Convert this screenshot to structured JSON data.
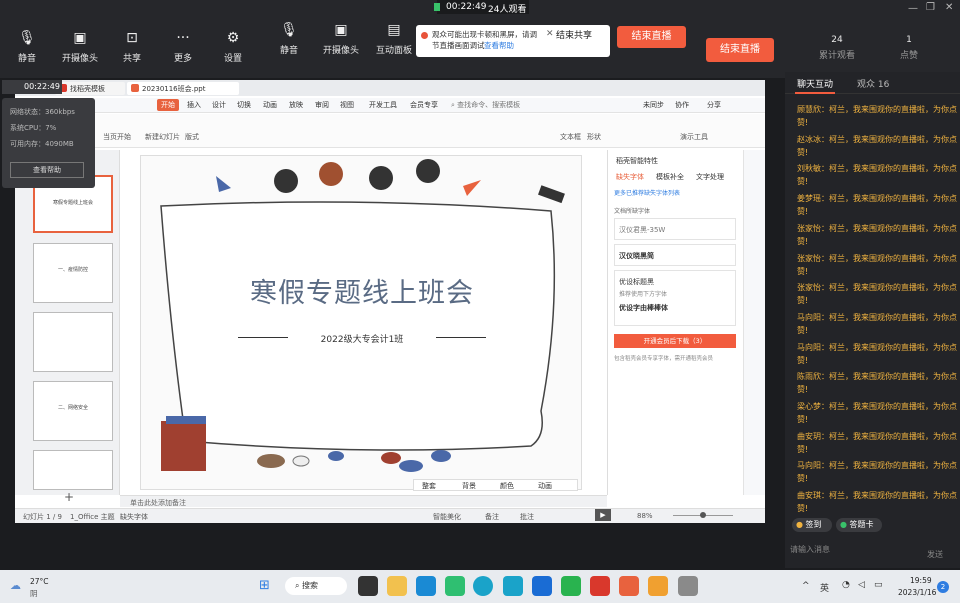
{
  "top": {
    "timer": "00:22:49",
    "viewers": "24人观看",
    "buttons": [
      {
        "label": "静音",
        "icon": "mic-icon"
      },
      {
        "label": "开摄像头",
        "icon": "camera-icon"
      },
      {
        "label": "共享",
        "icon": "share-icon"
      },
      {
        "label": "更多",
        "icon": "more-icon"
      },
      {
        "label": "设置",
        "icon": "gear-icon"
      },
      {
        "label": "静音",
        "icon": "mic-icon"
      },
      {
        "label": "开摄像头",
        "icon": "camera-icon"
      },
      {
        "label": "互动面板",
        "icon": "panel-icon"
      }
    ],
    "share_popup": {
      "text": "观众可能出现卡顿和黑屏，请调节直播画面调试",
      "link": "查看帮助",
      "end_share": "结束共享"
    },
    "end_live": "结束直播",
    "end_live_small": "结束直播",
    "stats": [
      {
        "value": "24",
        "label": "累计观看"
      },
      {
        "value": "1",
        "label": "点赞"
      }
    ]
  },
  "status_popup": {
    "time": "00:22:49",
    "lines": [
      "网络状态：360kbps",
      "系统CPU：7%",
      "可用内存：4090MB"
    ],
    "help_btn": "查看帮助"
  },
  "right": {
    "tabs": [
      "聊天互动",
      "观众 16"
    ],
    "messages": [
      {
        "name": "顾慧欣：",
        "text": "柯兰，我来围观你的直播啦，为你点赞!"
      },
      {
        "name": "赵冰冰：",
        "text": "柯兰，我来围观你的直播啦，为你点赞!"
      },
      {
        "name": "刘秋敏：",
        "text": "柯兰，我来围观你的直播啦，为你点赞!"
      },
      {
        "name": "姜梦瑶：",
        "text": "柯兰，我来围观你的直播啦，为你点赞!"
      },
      {
        "name": "张家怡：",
        "text": "柯兰，我来围观你的直播啦，为你点赞!"
      },
      {
        "name": "张家怡：",
        "text": "柯兰，我来围观你的直播啦，为你点赞!"
      },
      {
        "name": "张家怡：",
        "text": "柯兰，我来围观你的直播啦，为你点赞!"
      },
      {
        "name": "马向阳：",
        "text": "柯兰，我来围观你的直播啦，为你点赞!"
      },
      {
        "name": "马向阳：",
        "text": "柯兰，我来围观你的直播啦，为你点赞!"
      },
      {
        "name": "陈雨欣：",
        "text": "柯兰，我来围观你的直播啦，为你点赞!"
      },
      {
        "name": "梁心梦：",
        "text": "柯兰，我来围观你的直播啦，为你点赞!"
      },
      {
        "name": "曲安玥：",
        "text": "柯兰，我来围观你的直播啦，为你点赞!"
      },
      {
        "name": "马向阳：",
        "text": "柯兰，我来围观你的直播啦，为你点赞!"
      },
      {
        "name": "曲安琪：",
        "text": "柯兰，我来围观你的直播啦，为你点赞!"
      }
    ],
    "sign_in": "签到",
    "answer_card": "答题卡",
    "input_placeholder": "请输入消息",
    "send": "发送"
  },
  "ppt": {
    "tab1": "找稻壳模板",
    "tab2": "20230116班会.ppt",
    "menu": [
      "开始",
      "插入",
      "设计",
      "切换",
      "动画",
      "放映",
      "审阅",
      "视图",
      "开发工具",
      "会员专享"
    ],
    "search": "查找命令、搜索模板",
    "right_menu": [
      "未同步",
      "协作",
      "分享"
    ],
    "slide_title": "寒假专题线上班会",
    "slide_subtitle": "2022级大专会计1班",
    "thumb_labels": [
      "寒假专题线上班会",
      "一、疫情防控",
      "",
      "二、网络安全",
      ""
    ],
    "add_slide": "+",
    "notes": "单击此处添加备注",
    "status_left": "幻灯片 1 / 9",
    "theme": "1_Office 主题",
    "missing_font": "缺失字体",
    "zoom": "88%",
    "bottom_tools": [
      "智能美化",
      "备注",
      "批注"
    ],
    "float_tools": [
      "整套",
      "背景",
      "颜色",
      "动画"
    ],
    "side_panel": {
      "title": "稻壳智能特性",
      "tabs": [
        "缺失字体",
        "模板补全",
        "文字处理"
      ],
      "hint": "更多已推荐缺失字体列表",
      "sub": "文档所缺字体",
      "font1": "汉仪君黑-35W",
      "font2": "汉仪晓黑简",
      "opt": "优设标题黑",
      "opt_sub": "推荐使用下方字体",
      "font3": "优设字由棒棒体",
      "download": "开通会员后下载（3）",
      "note": "包含稻壳会员专享字体，需开通稻壳会员"
    }
  },
  "taskbar": {
    "weather_temp": "27°C",
    "weather_desc": "阴",
    "search": "搜索",
    "lang": "英",
    "time": "19:59",
    "date": "2023/1/16",
    "notif": "2"
  }
}
